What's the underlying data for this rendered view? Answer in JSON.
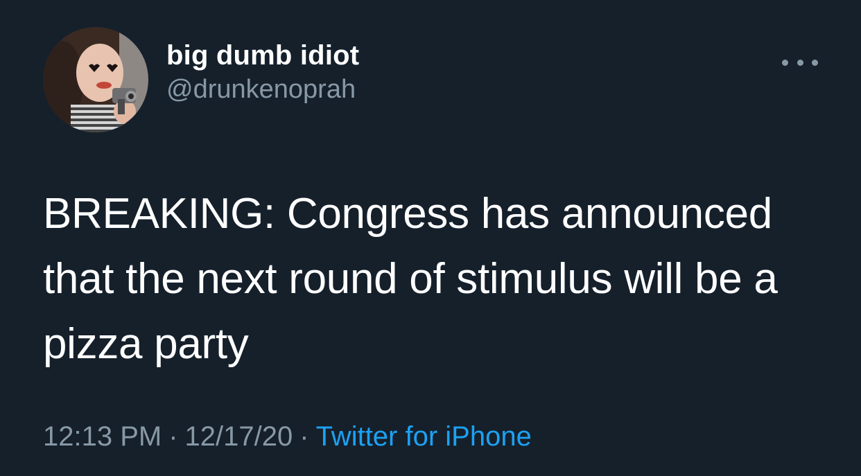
{
  "tweet": {
    "author": {
      "display_name": "big dumb idiot",
      "handle": "@drunkenoprah",
      "avatar_icon": "avatar-photo"
    },
    "text": "BREAKING: Congress has announced that the next round of stimulus will be a pizza party",
    "time": "12:13 PM",
    "date": "12/17/20",
    "separator": "·",
    "source": "Twitter for iPhone"
  },
  "colors": {
    "background": "#15202b",
    "primary_text": "#ffffff",
    "secondary_text": "#8899a6",
    "link": "#1da1f2"
  },
  "icons": {
    "more": "more-options-icon"
  }
}
